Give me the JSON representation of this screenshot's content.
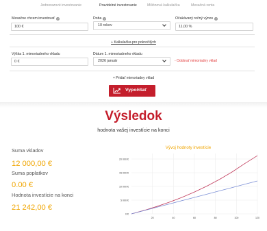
{
  "tabs": [
    {
      "label": "Jednorazové investovanie",
      "active": false
    },
    {
      "label": "Pravidelné investovanie",
      "active": true
    },
    {
      "label": "Miliónová kalkulačka",
      "active": false
    },
    {
      "label": "Mesačná renta",
      "active": false
    }
  ],
  "form": {
    "monthly_label": "Mesačne chcem investovať",
    "monthly_value": "100 €",
    "duration_label": "Doba",
    "duration_value": "10 rokov",
    "yield_label": "Očakávaný ročný výnos",
    "yield_value": "11,00 %",
    "advanced_link": "+ Kalkulačka pre pokročilých",
    "extra_amount_label": "Výška 1. mimoriadneho vkladu",
    "extra_amount_value": "0 €",
    "extra_date_label": "Dátum 1. mimoriadneho vkladu",
    "extra_date_value": "2026 január",
    "remove_link": "- Odobrať mimoriadny vklad",
    "add_link": "+ Pridať mimoriadny vklad",
    "calculate_label": "Vypočítať"
  },
  "result": {
    "title": "Výsledok",
    "subtitle": "hodnota vašej investície na konci",
    "deposits_label": "Suma vkladov",
    "deposits_value": "12 000,00 €",
    "fees_label": "Suma poplatkov",
    "fees_value": "0.00 €",
    "final_label": "Hodnota investície na konci",
    "final_value": "21 242,00 €"
  },
  "colors": {
    "accent": "#c41e2c",
    "highlight": "#f0a500",
    "line_value": "#c0395a",
    "line_deposits": "#7b8fd6"
  },
  "chart_data": {
    "type": "line",
    "title": "Vývoj hodnoty investície",
    "x_ticks": [
      20,
      40,
      60,
      80,
      100,
      120
    ],
    "y_ticks": [
      "0 €",
      "5 000 €",
      "10 000 €",
      "15 000 €",
      "20 000 €"
    ],
    "xlim": [
      0,
      120
    ],
    "ylim": [
      0,
      22000
    ],
    "series": [
      {
        "key": "value",
        "x": [
          0,
          12,
          24,
          36,
          48,
          60,
          72,
          84,
          96,
          108,
          120
        ],
        "values": [
          0,
          1263,
          2673,
          4247,
          6003,
          7963,
          10150,
          12592,
          15316,
          18357,
          21242
        ]
      },
      {
        "key": "deposits",
        "x": [
          0,
          12,
          24,
          36,
          48,
          60,
          72,
          84,
          96,
          108,
          120
        ],
        "values": [
          0,
          1200,
          2400,
          3600,
          4800,
          6000,
          7200,
          8400,
          9600,
          10800,
          12000
        ]
      }
    ]
  }
}
